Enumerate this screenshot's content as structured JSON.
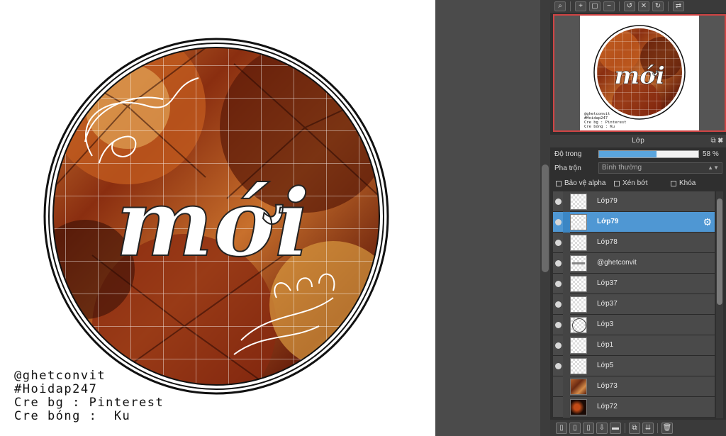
{
  "canvas": {
    "title_text": "mới",
    "credits": [
      "@ghetconvit",
      "#Hoidap247",
      "Cre bg : Pinterest",
      "Cre bóng :  Ku"
    ]
  },
  "navigator": {
    "toolbar_icons": [
      "zoom-icon",
      "zoom-in-icon",
      "fit-icon",
      "zoom-out-icon",
      "rotate-left-icon",
      "reset-icon",
      "rotate-right-icon",
      "flip-icon"
    ],
    "mini_title": "mới",
    "mini_credits": [
      "@ghetconvit",
      "#Hoidap247",
      "Cre bg : Pinterest",
      "Cre bóng :  Ku"
    ]
  },
  "layers_panel": {
    "title": "Lớp",
    "opacity_label": "Độ trong",
    "opacity_value": "58 %",
    "opacity_fraction": 0.58,
    "blend_label": "Pha trộn",
    "blend_value": "Bình thường",
    "checkboxes": {
      "protect_alpha": "Bảo vệ alpha",
      "clipping": "Xén bớt",
      "lock": "Khóa"
    },
    "layers": [
      {
        "name": "Lớp79",
        "visible": true,
        "selected": false,
        "thumb": "blank"
      },
      {
        "name": "Lớp79",
        "visible": true,
        "selected": true,
        "thumb": "blank"
      },
      {
        "name": "Lớp78",
        "visible": true,
        "selected": false,
        "thumb": "blank"
      },
      {
        "name": "@ghetconvit",
        "visible": true,
        "selected": false,
        "thumb": "text"
      },
      {
        "name": "Lớp37",
        "visible": true,
        "selected": false,
        "thumb": "blank"
      },
      {
        "name": "Lớp37",
        "visible": true,
        "selected": false,
        "thumb": "blank"
      },
      {
        "name": "Lớp3",
        "visible": true,
        "selected": false,
        "thumb": "circle"
      },
      {
        "name": "Lớp1",
        "visible": true,
        "selected": false,
        "thumb": "blank"
      },
      {
        "name": "Lớp5",
        "visible": true,
        "selected": false,
        "thumb": "blank"
      },
      {
        "name": "Lớp73",
        "visible": false,
        "selected": false,
        "thumb": "photo1"
      },
      {
        "name": "Lớp72",
        "visible": false,
        "selected": false,
        "thumb": "photo2"
      }
    ]
  },
  "colors": {
    "selection": "#4f97d3",
    "opacity_fill": "#5aa5dd",
    "nav_border": "#d04444"
  }
}
